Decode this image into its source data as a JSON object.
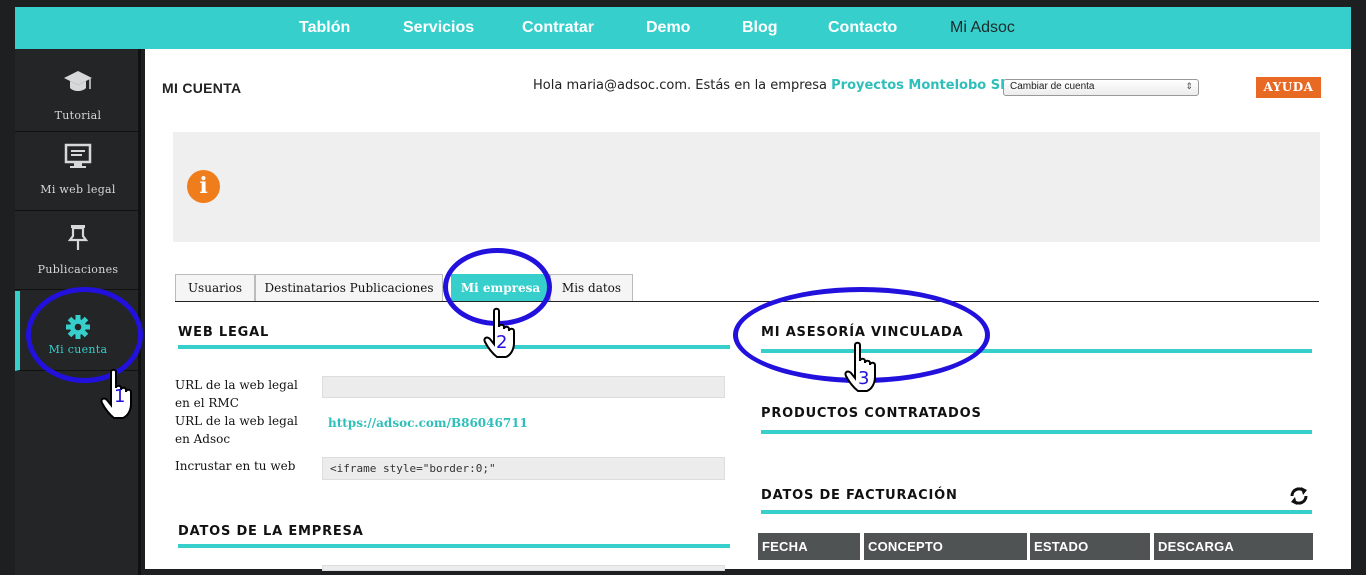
{
  "topnav": {
    "items": [
      {
        "label": "Tablón"
      },
      {
        "label": "Servicios"
      },
      {
        "label": "Contratar"
      },
      {
        "label": "Demo"
      },
      {
        "label": "Blog"
      },
      {
        "label": "Contacto"
      },
      {
        "label": "Mi Adsoc",
        "active": true
      }
    ]
  },
  "sidebar": {
    "items": [
      {
        "label": "Tutorial",
        "icon": "graduation-cap-icon"
      },
      {
        "label": "Mi web legal",
        "icon": "monitor-icon"
      },
      {
        "label": "Publicaciones",
        "icon": "pushpin-icon"
      },
      {
        "label": "Mi cuenta",
        "icon": "gear-icon",
        "active": true
      }
    ]
  },
  "header": {
    "title": "MI CUENTA",
    "greeting": "Hola maria@adsoc.com. Estás en la empresa",
    "company": "Proyectos Montelobo SL",
    "account_select": "Cambiar de cuenta",
    "help_label": "AYUDA"
  },
  "info": {
    "icon": "info-icon"
  },
  "tabs": [
    {
      "label": "Usuarios"
    },
    {
      "label": "Destinatarios Publicaciones"
    },
    {
      "label": "Mi empresa",
      "active": true
    },
    {
      "label": "Mis datos"
    }
  ],
  "web_legal": {
    "title": "WEB LEGAL",
    "rmc_label": "URL de la web legal en el RMC",
    "rmc_value": "",
    "adsoc_label": "URL de la web legal en Adsoc",
    "adsoc_value": "https://adsoc.com/B86046711",
    "embed_label": "Incrustar en tu web",
    "embed_value": "<iframe style=\"border:0;\""
  },
  "empresa": {
    "title": "DATOS DE LA EMPRESA"
  },
  "asesoria": {
    "title": "MI ASESORÍA VINCULADA"
  },
  "productos": {
    "title": "PRODUCTOS CONTRATADOS"
  },
  "facturacion": {
    "title": "DATOS DE FACTURACIÓN",
    "columns": [
      "FECHA",
      "CONCEPTO",
      "ESTADO",
      "DESCARGA"
    ]
  },
  "annotations": [
    "1",
    "2",
    "3"
  ],
  "colors": {
    "accent": "#36cfcc",
    "help": "#e76924",
    "info": "#f07d1c",
    "annotation": "#2211dd"
  }
}
